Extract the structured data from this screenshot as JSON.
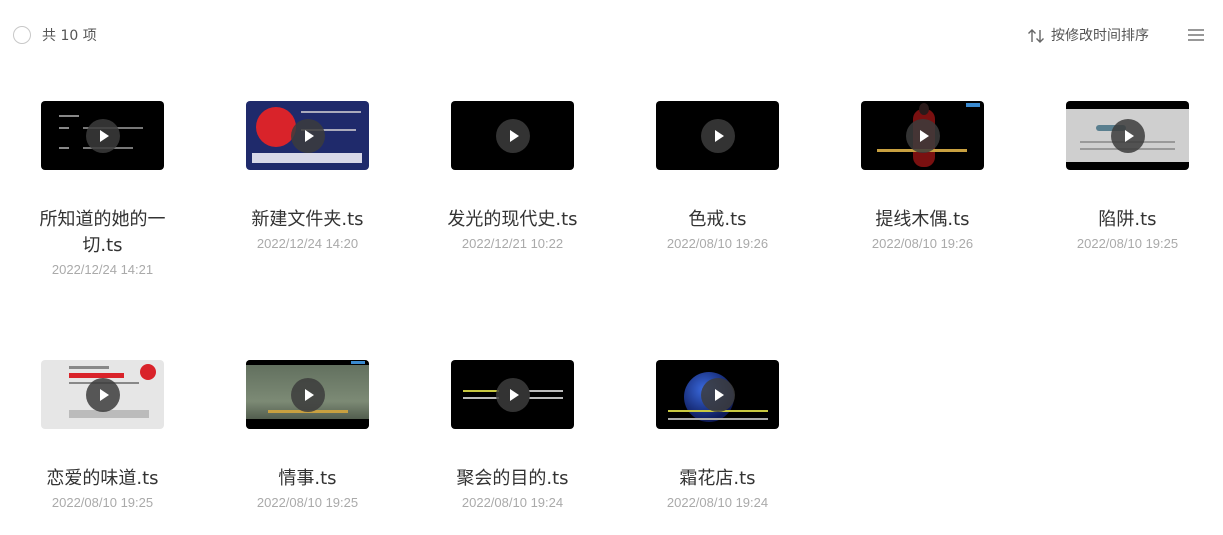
{
  "header": {
    "count_label": "共 10 项",
    "sort_label": "按修改时间排序"
  },
  "files": [
    {
      "name": "所知道的她的一切.ts",
      "modified": "2022/12/24 14:21",
      "thumb": "dark-credits"
    },
    {
      "name": "新建文件夹.ts",
      "modified": "2022/12/24 14:20",
      "thumb": "navy-rating"
    },
    {
      "name": "发光的现代史.ts",
      "modified": "2022/12/21 10:22",
      "thumb": "black"
    },
    {
      "name": "色戒.ts",
      "modified": "2022/08/10 19:26",
      "thumb": "black"
    },
    {
      "name": "提线木偶.ts",
      "modified": "2022/08/10 19:26",
      "thumb": "red-figure"
    },
    {
      "name": "陷阱.ts",
      "modified": "2022/08/10 19:25",
      "thumb": "gray-logo"
    },
    {
      "name": "恋爱的味道.ts",
      "modified": "2022/08/10 19:25",
      "thumb": "white-rating"
    },
    {
      "name": "情事.ts",
      "modified": "2022/08/10 19:25",
      "thumb": "street"
    },
    {
      "name": "聚会的目的.ts",
      "modified": "2022/08/10 19:24",
      "thumb": "black-subtitle"
    },
    {
      "name": "霜花店.ts",
      "modified": "2022/08/10 19:24",
      "thumb": "blue-orb"
    }
  ],
  "colors": {
    "text": "#333333",
    "muted": "#aaaaaa",
    "rating_red": "#d9232a"
  }
}
